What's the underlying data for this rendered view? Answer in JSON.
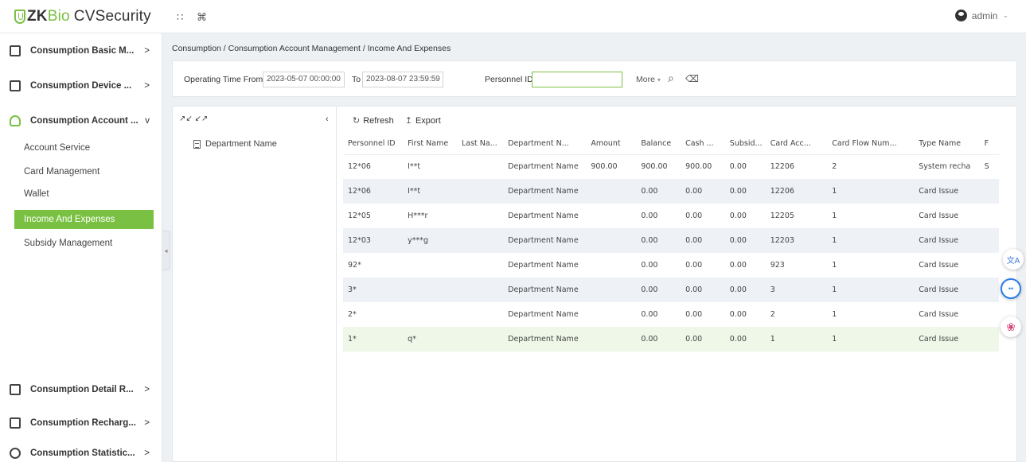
{
  "app": {
    "brand_zk": "ZK",
    "brand_bio": "Bio",
    "brand_rest": "CVSecurity",
    "icons": [
      "grid-icon",
      "command-icon"
    ]
  },
  "user": {
    "name": "admin"
  },
  "sidebar": {
    "groups_top": [
      {
        "label": "Consumption Basic M...",
        "icon": "basic-management-icon",
        "arrow": ">"
      },
      {
        "label": "Consumption Device ...",
        "icon": "device-icon",
        "arrow": ">"
      },
      {
        "label": "Consumption Account ...",
        "icon": "account-icon",
        "arrow": "v"
      }
    ],
    "items": [
      {
        "label": "Account Service"
      },
      {
        "label": "Card Management"
      },
      {
        "label": "Wallet"
      },
      {
        "label": "Income And Expenses",
        "active": true
      },
      {
        "label": "Subsidy Management"
      }
    ],
    "groups_bottom": [
      {
        "label": "Consumption Detail R...",
        "icon": "detail-report-icon",
        "arrow": ">"
      },
      {
        "label": "Consumption Recharg...",
        "icon": "recharge-icon",
        "arrow": ">"
      },
      {
        "label": "Consumption Statistic...",
        "icon": "statistic-icon",
        "arrow": ">"
      }
    ]
  },
  "breadcrumb": "Consumption / Consumption Account Management / Income And Expenses",
  "filters": {
    "from_label": "Operating Time From",
    "from_value": "2023-05-07 00:00:00",
    "to_label": "To",
    "to_value": "2023-08-07 23:59:59",
    "personnel_label": "Personnel ID",
    "personnel_value": "",
    "more_label": "More"
  },
  "tree": {
    "root": "Department Name"
  },
  "toolbar": {
    "refresh": "Refresh",
    "export": "Export"
  },
  "table": {
    "columns": [
      "Personnel ID",
      "First Name",
      "Last Na...",
      "Department N...",
      "Amount",
      "Balance",
      "Cash ...",
      "Subsid...",
      "Card Acc...",
      "Card Flow Num...",
      "Type Name",
      "F"
    ],
    "rows": [
      [
        "12*06",
        "I**t",
        "",
        "Department Name",
        "900.00",
        "900.00",
        "900.00",
        "0.00",
        "12206",
        "2",
        "System recha",
        "S"
      ],
      [
        "12*06",
        "I**t",
        "",
        "Department Name",
        "",
        "0.00",
        "0.00",
        "0.00",
        "12206",
        "1",
        "Card Issue",
        ""
      ],
      [
        "12*05",
        "H***r",
        "",
        "Department Name",
        "",
        "0.00",
        "0.00",
        "0.00",
        "12205",
        "1",
        "Card Issue",
        ""
      ],
      [
        "12*03",
        "y***g",
        "",
        "Department Name",
        "",
        "0.00",
        "0.00",
        "0.00",
        "12203",
        "1",
        "Card Issue",
        ""
      ],
      [
        "92*",
        "",
        "",
        "Department Name",
        "",
        "0.00",
        "0.00",
        "0.00",
        "923",
        "1",
        "Card Issue",
        ""
      ],
      [
        "3*",
        "",
        "",
        "Department Name",
        "",
        "0.00",
        "0.00",
        "0.00",
        "3",
        "1",
        "Card Issue",
        ""
      ],
      [
        "2*",
        "",
        "",
        "Department Name",
        "",
        "0.00",
        "0.00",
        "0.00",
        "2",
        "1",
        "Card Issue",
        ""
      ],
      [
        "1*",
        "q*",
        "",
        "Department Name",
        "",
        "0.00",
        "0.00",
        "0.00",
        "1",
        "1",
        "Card Issue",
        ""
      ]
    ]
  },
  "colors": {
    "brand_green": "#7ac143",
    "row_alt": "#eef2f7",
    "row_selected": "#eef7e8"
  }
}
